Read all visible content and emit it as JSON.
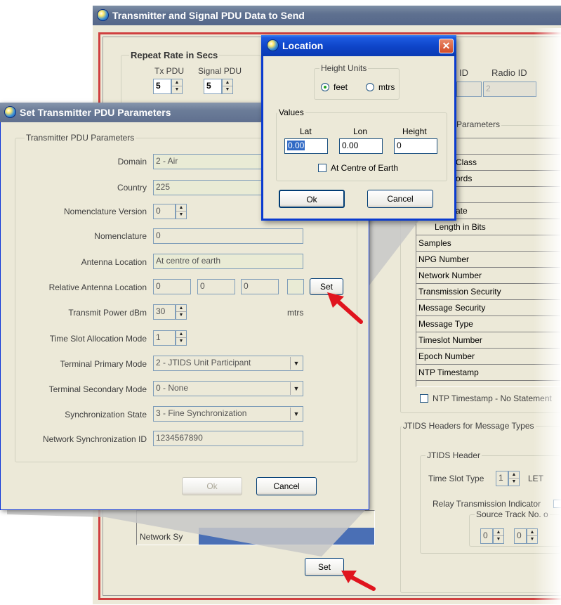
{
  "main_window": {
    "title": "Transmitter and Signal PDU Data to Send",
    "repeat_rate": {
      "title": "Repeat Rate in Secs",
      "tx_label": "Tx PDU",
      "signal_label": "Signal PDU",
      "tx_value": "5",
      "signal_value": "5"
    },
    "id_label": "ID",
    "radio_id_label": "Radio ID",
    "radio_id_value": "2",
    "parameters_group": "Parameters",
    "list_items": [
      "Class",
      "ords",
      "ate",
      "Length in Bits",
      "Samples",
      "NPG Number",
      "Network Number",
      "Transmission Security",
      "Message Security",
      "Message Type",
      "Timeslot Number",
      "Epoch Number",
      "NTP Timestamp"
    ],
    "ntp_checkbox": "NTP Timestamp - No Statement",
    "jtids_group": "JTIDS Headers for Message Types",
    "jtids_header": "JTIDS Header",
    "time_slot_type_label": "Time Slot Type",
    "time_slot_type_value": "1",
    "let_label": "LET",
    "relay_label": "Relay Transmission Indicator",
    "source_track_label": "Source Track No. o",
    "source_vals": [
      "0",
      "0"
    ],
    "network_row": "Network Sy",
    "set_button": "Set"
  },
  "transmitter_dialog": {
    "title": "Set Transmitter PDU Parameters",
    "group_title": "Transmitter PDU Parameters",
    "domain_label": "Domain",
    "domain_value": "2 - Air",
    "country_label": "Country",
    "country_value": "225",
    "nomenclature_version_label": "Nomenclature Version",
    "nomenclature_version_value": "0",
    "nomenclature_label": "Nomenclature",
    "nomenclature_value": "0",
    "antenna_location_label": "Antenna Location",
    "antenna_location_value": "At centre of earth",
    "relative_antenna_label": "Relative Antenna Location",
    "relative_values": [
      "0",
      "0",
      "0"
    ],
    "set_button": "Set",
    "transmit_power_label": "Transmit Power dBm",
    "transmit_power_value": "30",
    "mtrs_label": "mtrs",
    "time_slot_label": "Time Slot Allocation Mode",
    "time_slot_value": "1",
    "terminal_primary_label": "Terminal Primary Mode",
    "terminal_primary_value": "2 - JTIDS Unit Participant",
    "terminal_secondary_label": "Terminal Secondary Mode",
    "terminal_secondary_value": "0 - None",
    "sync_state_label": "Synchronization State",
    "sync_state_value": "3 - Fine Synchronization",
    "network_sync_label": "Network Synchronization ID",
    "network_sync_value": "1234567890",
    "ok_button": "Ok",
    "cancel_button": "Cancel"
  },
  "location_dialog": {
    "title": "Location",
    "height_units_group": "Height Units",
    "feet_label": "feet",
    "mtrs_label": "mtrs",
    "values_group": "Values",
    "lat_label": "Lat",
    "lon_label": "Lon",
    "height_label": "Height",
    "lat_value": "0.00",
    "lon_value": "0.00",
    "height_value": "0",
    "centre_checkbox": "At Centre of Earth",
    "ok_button": "Ok",
    "cancel_button": "Cancel"
  },
  "colors": {
    "title_blue": "#0a3bb3",
    "window_bg": "#ece9d8",
    "frame_red": "#d04040",
    "arrow_red": "#e0141e"
  }
}
